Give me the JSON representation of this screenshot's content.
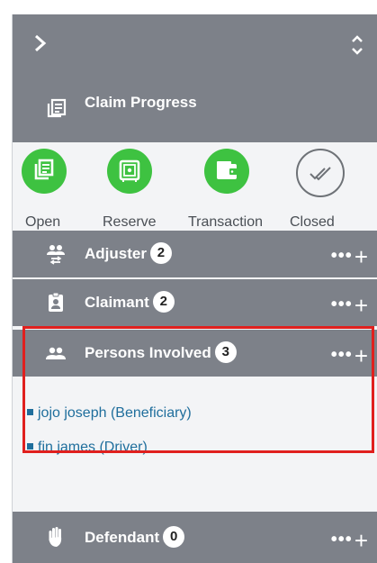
{
  "header": {
    "expand_icon": "chevron-right-icon",
    "sort_icon": "up-down-chevron-icon"
  },
  "claim_progress": {
    "title": "Claim Progress",
    "steps": [
      {
        "label": "Open",
        "icon": "document-list-icon",
        "status": "done"
      },
      {
        "label": "Reserve",
        "icon": "safe-icon",
        "status": "done"
      },
      {
        "label": "Transaction",
        "icon": "wallet-icon",
        "status": "done"
      },
      {
        "label": "Closed",
        "icon": "double-check-icon",
        "status": "pending"
      }
    ]
  },
  "sections": {
    "adjuster": {
      "label": "Adjuster",
      "count": "2"
    },
    "claimant": {
      "label": "Claimant",
      "count": "2"
    },
    "persons_involved": {
      "label": "Persons Involved",
      "count": "3"
    },
    "defendant": {
      "label": "Defendant",
      "count": "0"
    }
  },
  "actions": {
    "more": "•••",
    "add": "+"
  },
  "persons_involved_list": [
    {
      "text": "jojo joseph (Beneficiary)"
    },
    {
      "text": "fin james (Driver)"
    }
  ],
  "colors": {
    "header_gray": "#7d8189",
    "success_green": "#3ec241",
    "link_blue": "#1f6e9c",
    "highlight_red": "#e0201e"
  }
}
